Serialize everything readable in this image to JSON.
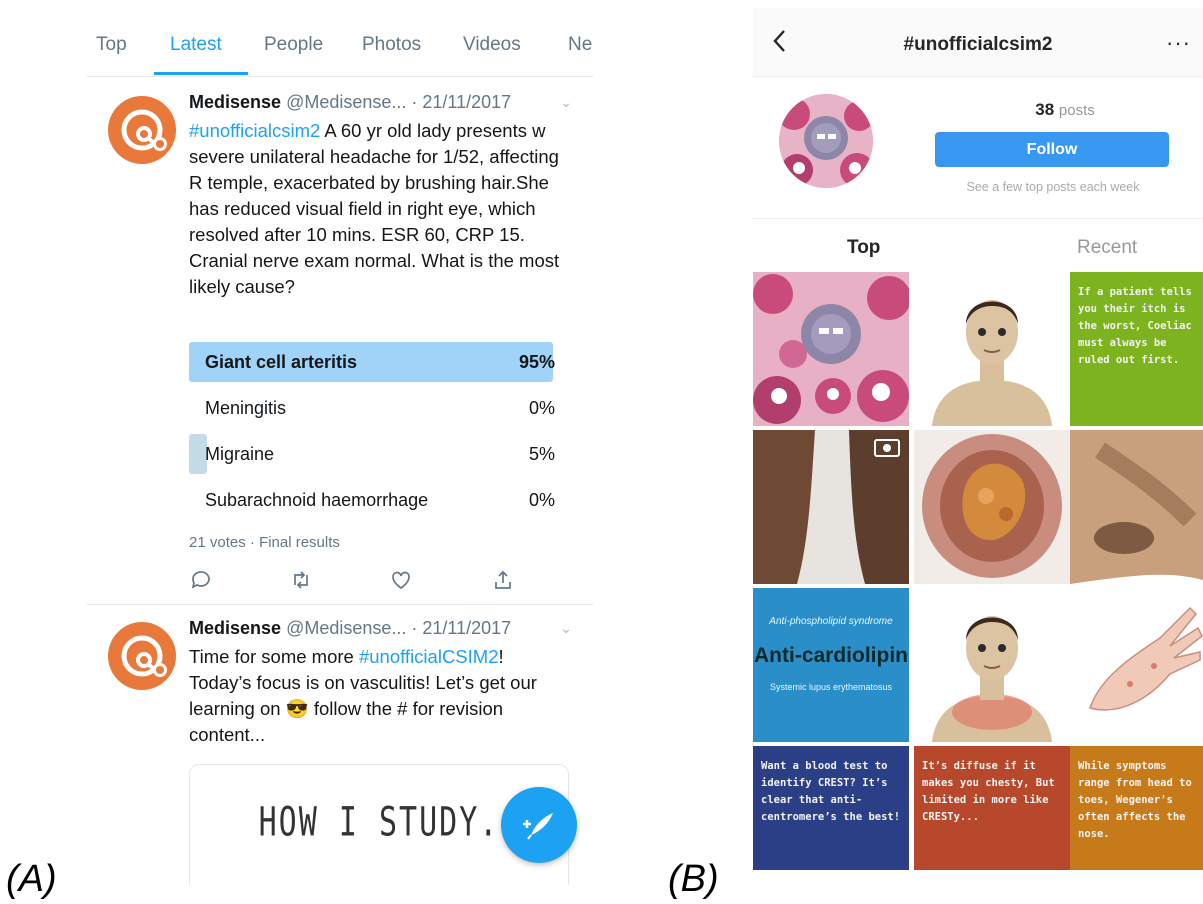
{
  "twitter": {
    "tabs": [
      "Top",
      "Latest",
      "People",
      "Photos",
      "Videos",
      "Ne"
    ],
    "active_tab": "Latest",
    "tweets": [
      {
        "author": "Medisense",
        "handle": "@Medisense...",
        "date": "· 21/11/2017",
        "hashtag": "#unofficialcsim2",
        "text": " A 60 yr old lady presents w severe unilateral headache for 1/52, affecting R temple, exacerbated by brushing hair.She has reduced visual field in right eye, which resolved after 10 mins. ESR 60, CRP 15. Cranial nerve exam normal. What is the most likely cause?",
        "poll": [
          {
            "label": "Giant cell arteritis",
            "pct": "95%",
            "fraction": 0.95
          },
          {
            "label": "Meningitis",
            "pct": "0%",
            "fraction": 0.0
          },
          {
            "label": "Migraine",
            "pct": "5%",
            "fraction": 0.05
          },
          {
            "label": "Subarachnoid haemorrhage",
            "pct": "0%",
            "fraction": 0.0
          }
        ],
        "votes": "21 votes · Final results"
      },
      {
        "author": "Medisense",
        "handle": "@Medisense...",
        "date": "· 21/11/2017",
        "text_before": "Time for some more ",
        "hashtag": "#unofficialCSIM2",
        "text_after": "! Today’s focus is on vasculitis! Let’s get our learning on 😎 follow the # for revision content...",
        "card_text": "HOW I STUDY."
      }
    ],
    "icons": [
      "reply-icon",
      "retweet-icon",
      "like-icon",
      "share-icon",
      "compose-icon"
    ],
    "colors": {
      "accent": "#1da1f2",
      "poll_winner": "#9fd3f7",
      "avatar": "#e8793a"
    }
  },
  "instagram": {
    "title": "#unofficialcsim2",
    "more": "···",
    "posts_count": "38",
    "posts_label": "posts",
    "follow_label": "Follow",
    "subtitle": "See a few top posts each week",
    "tabs": [
      "Top",
      "Recent"
    ],
    "tiles": [
      {
        "text": "If a patient tells you their itch is the worst, Coeliac must always be ruled out first."
      },
      {
        "small": "Anti-phospholipid syndrome",
        "big": "Anti-cardiolipin",
        "sub": "Systemic lupus erythematosus"
      },
      {
        "text": "Want a blood test to identify CREST? It’s clear that anti-centromere’s the best!"
      },
      {
        "text": "It’s diffuse if it makes you chesty, But limited in more like CRESTy..."
      },
      {
        "text": "While symptoms range from head to toes, Wegener’s often affects the nose."
      }
    ],
    "colors": {
      "follow": "#3897f0"
    }
  },
  "labels": {
    "left": "(A)",
    "right": "(B)"
  }
}
